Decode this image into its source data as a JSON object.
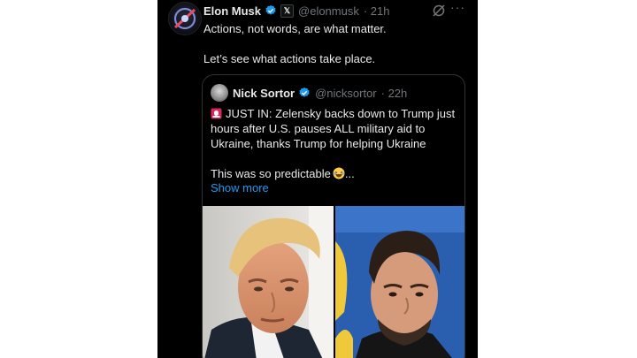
{
  "tweet": {
    "author_name": "Elon Musk",
    "author_handle": "@elonmusk",
    "time": "· 21h",
    "x_badge": "𝕏",
    "more_label": "···",
    "lines": [
      "Actions, not words, are what matter.",
      "Let’s see what actions take place."
    ]
  },
  "quote": {
    "author_name": "Nick Sortor",
    "author_handle": "@nicksortor",
    "time": "· 22h",
    "text_line1": "JUST IN: Zelensky backs down to Trump just hours after U.S. pauses ALL military aid to Ukraine, thanks Trump for helping Ukraine",
    "text_line2": "This was so predictable",
    "text_line2_suffix": "...",
    "show_more": "Show more"
  },
  "colors": {
    "background": "#000000",
    "text": "#e7e9ea",
    "muted": "#71767b",
    "link": "#1d9bf0",
    "verified": "#1d9bf0",
    "border": "#2f3336"
  },
  "icons": [
    "verified-badge-icon",
    "x-affiliate-badge-icon",
    "grok-icon",
    "more-icon",
    "siren-emoji-icon",
    "laughing-emoji-icon"
  ]
}
